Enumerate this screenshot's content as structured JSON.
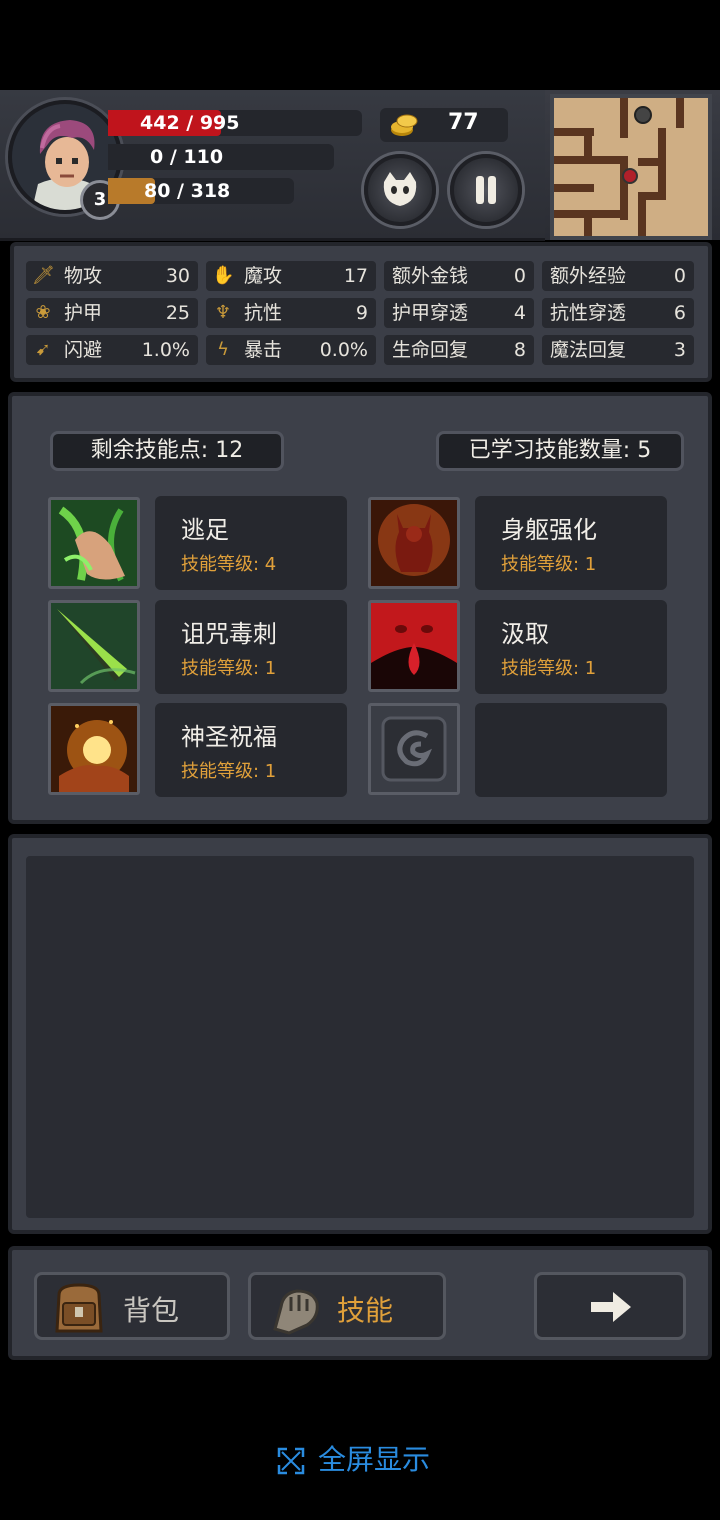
{
  "hud": {
    "hp": "442 / 995",
    "hp_ratio": 0.444,
    "mp": "0 / 110",
    "mp_ratio": 0,
    "xp": "80 / 318",
    "xp_ratio": 0.252,
    "level": "3",
    "gold": "77"
  },
  "stats": [
    {
      "label": "物攻",
      "value": "30",
      "icon": "sword-icon"
    },
    {
      "label": "魔攻",
      "value": "17",
      "icon": "magic-hand-icon"
    },
    {
      "label": "额外金钱",
      "value": "0"
    },
    {
      "label": "额外经验",
      "value": "0"
    },
    {
      "label": "护甲",
      "value": "25",
      "icon": "paw-icon"
    },
    {
      "label": "抗性",
      "value": "9",
      "icon": "resist-icon"
    },
    {
      "label": "护甲穿透",
      "value": "4"
    },
    {
      "label": "抗性穿透",
      "value": "6"
    },
    {
      "label": "闪避",
      "value": "1.0%",
      "icon": "run-icon"
    },
    {
      "label": "暴击",
      "value": "0.0%",
      "icon": "lightning-icon"
    },
    {
      "label": "生命回复",
      "value": "8"
    },
    {
      "label": "魔法回复",
      "value": "3"
    }
  ],
  "skills_header": {
    "remaining": "剩余技能点: 12",
    "learned": "已学习技能数量: 5"
  },
  "skills": [
    {
      "name": "逃足",
      "level": "技能等级: 4"
    },
    {
      "name": "身躯强化",
      "level": "技能等级: 1"
    },
    {
      "name": "诅咒毒刺",
      "level": "技能等级: 1"
    },
    {
      "name": "汲取",
      "level": "技能等级: 1"
    },
    {
      "name": "神圣祝福",
      "level": "技能等级: 1"
    }
  ],
  "bottom": {
    "bag_label": "背包",
    "skill_label": "技能"
  },
  "fullscreen_label": "全屏显示",
  "colors": {
    "hp": "#c0141c",
    "xp": "#b87a2a",
    "level_text": "#e0a03a",
    "fullscreen": "#2a8ce0"
  }
}
